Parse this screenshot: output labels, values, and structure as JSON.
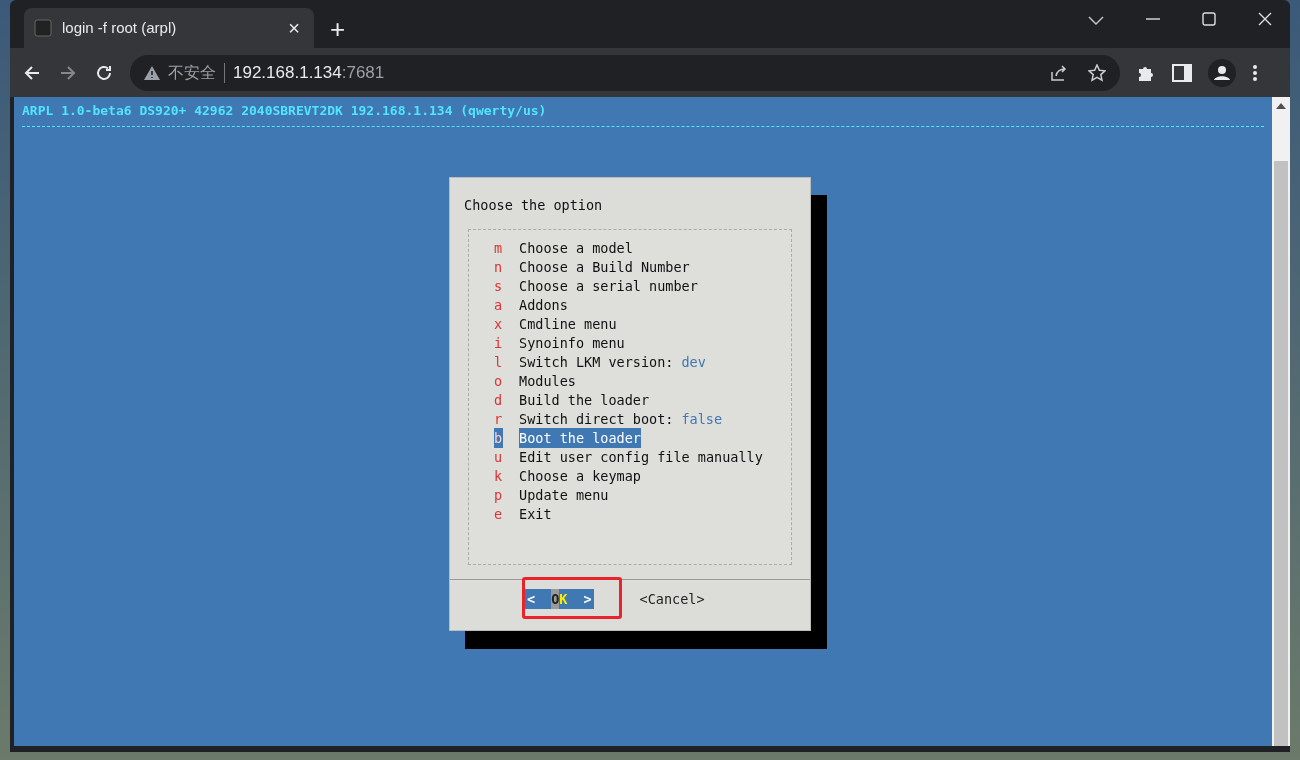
{
  "tab": {
    "title": "login -f root (arpl)",
    "close": "×",
    "new": "+"
  },
  "address_bar": {
    "security": "不安全",
    "host": "192.168.1.134",
    "port": ":7681"
  },
  "terminal": {
    "header": "ARPL 1.0-beta6 DS920+ 42962 2040SBREVT2DK 192.168.1.134 (qwerty/us)"
  },
  "dialog": {
    "title": "Choose the option",
    "items": [
      {
        "key": "m",
        "label": "Choose a model",
        "selected": false
      },
      {
        "key": "n",
        "label": "Choose a Build Number",
        "selected": false
      },
      {
        "key": "s",
        "label": "Choose a serial number",
        "selected": false
      },
      {
        "key": "a",
        "label": "Addons",
        "selected": false
      },
      {
        "key": "x",
        "label": "Cmdline menu",
        "selected": false
      },
      {
        "key": "i",
        "label": "Synoinfo menu",
        "selected": false
      },
      {
        "key": "l",
        "label": "Switch LKM version:",
        "value": "dev",
        "selected": false
      },
      {
        "key": "o",
        "label": "Modules",
        "selected": false
      },
      {
        "key": "d",
        "label": "Build the loader",
        "selected": false
      },
      {
        "key": "r",
        "label": "Switch direct boot:",
        "value": "false",
        "selected": false
      },
      {
        "key": "b",
        "label": "Boot the loader",
        "selected": true
      },
      {
        "key": "u",
        "label": "Edit user config file manually",
        "selected": false
      },
      {
        "key": "k",
        "label": "Choose a keymap",
        "selected": false
      },
      {
        "key": "p",
        "label": "Update menu",
        "selected": false
      },
      {
        "key": "e",
        "label": "Exit",
        "selected": false
      }
    ],
    "buttons": [
      {
        "open": "<",
        "label": "OK",
        "close": ">",
        "selected": true
      },
      {
        "open": "<",
        "label": "Cancel",
        "close": ">",
        "selected": false
      }
    ]
  }
}
